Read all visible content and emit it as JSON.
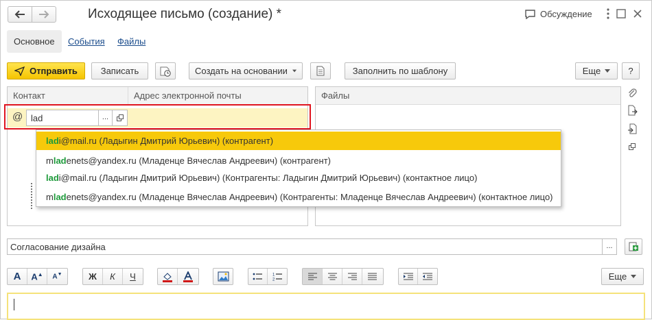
{
  "window": {
    "title": "Исходящее письмо  (создание) *",
    "discussion_label": "Обсуждение",
    "more_icon": "vertical-dots-icon",
    "fullscreen_icon": "expand-icon",
    "close_icon": "close-icon"
  },
  "tabs": [
    {
      "label": "Основное",
      "active": true
    },
    {
      "label": "События",
      "active": false
    },
    {
      "label": "Файлы",
      "active": false
    }
  ],
  "toolbar": {
    "send_label": "Отправить",
    "save_label": "Записать",
    "create_based_on_label": "Создать на основании",
    "fill_template_label": "Заполнить по шаблону",
    "more_label": "Еще",
    "help_label": "?"
  },
  "contacts_table": {
    "columns": [
      "Контакт",
      "Адрес электронной почты"
    ],
    "row": {
      "prefix": "@",
      "contact_value": "lad",
      "choice_label": "...",
      "email_value": ""
    }
  },
  "files_panel": {
    "header": "Файлы"
  },
  "autocomplete": {
    "items": [
      {
        "pre": "",
        "match": "lad",
        "post": "i@mail.ru (Ладыгин Дмитрий Юрьевич) (контрагент)",
        "selected": true
      },
      {
        "pre": "m",
        "match": "lad",
        "post": "enets@yandex.ru (Младенце Вячеслав Андреевич) (контрагент)",
        "selected": false
      },
      {
        "pre": "",
        "match": "lad",
        "post": "i@mail.ru (Ладыгин Дмитрий Юрьевич) (Контрагенты: Ладыгин Дмитрий Юрьевич) (контактное лицо)",
        "selected": false
      },
      {
        "pre": "m",
        "match": "lad",
        "post": "enets@yandex.ru (Младенце Вячеслав Андреевич) (Контрагенты: Младенце Вячеслав Андреевич) (контактное лицо)",
        "selected": false
      }
    ]
  },
  "subject": {
    "value": "Согласование дизайна",
    "choice_label": "..."
  },
  "format_toolbar": {
    "bold_label": "Ж",
    "italic_label": "К",
    "underline_label": "Ч",
    "more_label": "Еще"
  },
  "colors": {
    "accent": "#f7c90b",
    "highlight_text": "#1d9a3a",
    "focus_border": "#e0141e",
    "link": "#1a4c8c",
    "input_yellow": "#fdf4c2"
  }
}
